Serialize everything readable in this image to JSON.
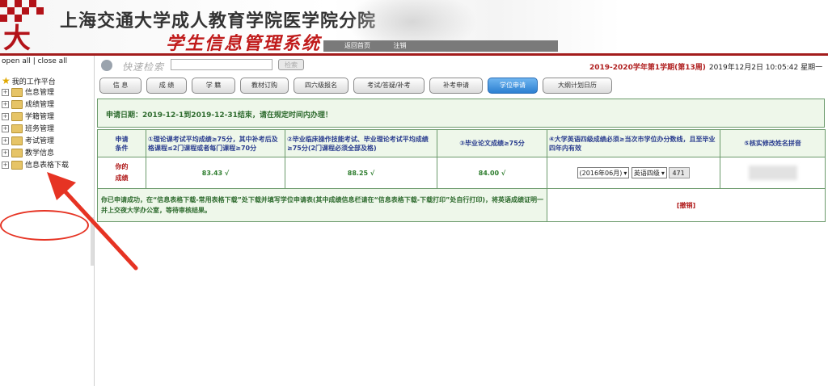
{
  "header": {
    "school_name": "上海交通大学成人教育学院医学院分院",
    "system_name": "学生信息管理系统",
    "topbar": [
      "返回首页",
      "注销"
    ],
    "logo_glyph": "大"
  },
  "sidebar": {
    "open_all": "open all",
    "close_all": "close all",
    "root_label": "我的工作平台",
    "items": [
      {
        "label": "信息管理"
      },
      {
        "label": "成绩管理"
      },
      {
        "label": "学籍管理"
      },
      {
        "label": "班务管理"
      },
      {
        "label": "考试管理"
      },
      {
        "label": "教学信息"
      },
      {
        "label": "信息表格下载"
      }
    ]
  },
  "search": {
    "label": "快速检索",
    "button": "检索",
    "value": ""
  },
  "status": {
    "semester": "2019-2020学年第1学期(第13周)",
    "datetime": "2019年12月2日 10:05:42 星期一"
  },
  "tabs": [
    {
      "label": "信 息",
      "active": false
    },
    {
      "label": "成 绩",
      "active": false
    },
    {
      "label": "学 籍",
      "active": false
    },
    {
      "label": "教材订购",
      "active": false
    },
    {
      "label": "四六级报名",
      "active": false
    },
    {
      "label": "考试/答疑/补考",
      "active": false
    },
    {
      "label": "补考申请",
      "active": false
    },
    {
      "label": "学位申请",
      "active": true
    },
    {
      "label": "大纲计划日历",
      "active": false
    }
  ],
  "notice": "申请日期：2019-12-1到2019-12-31结束，请在规定时间内办理！",
  "table": {
    "req_header": "申请\n条件",
    "conditions": [
      "①理论课考试平均成绩≥75分，其中补考后及格课程≤2门课程或者每门课程≥70分",
      "②毕业临床操作技能考试、毕业理论考试平均成绩≥75分(2门课程必须全部及格)",
      "③毕业论文成绩≥75分",
      "④大学英语四级成绩必须≥当次市学位办分数线，且至毕业四年内有效",
      "⑤核实修改姓名拼音"
    ],
    "your_label": "你的\n成绩",
    "scores": [
      "83.43 √",
      "88.25 √",
      "84.00 √"
    ],
    "cet_date": "(2016年06月)",
    "cet_level": "英语四级",
    "cet_score": "471",
    "message": "你已申请成功，在“信息表格下载-常用表格下载”处下载并填写学位申请表(其中成绩信息栏请在“信息表格下载-下载打印”处自行打印)，将英语成绩证明一并上交夜大学办公室，等待审核结果。",
    "cancel": "[撤销]"
  },
  "colors": {
    "accent_red": "#b31218",
    "tab_active": "#2c80d1",
    "annotation": "#e63323"
  }
}
